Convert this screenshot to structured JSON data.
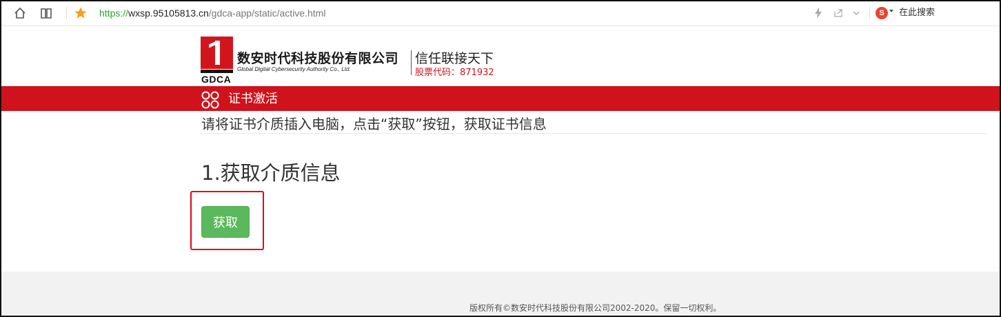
{
  "browser": {
    "url_scheme": "https://",
    "url_host": "wxsp.95105813.cn",
    "url_path": "/gdca-app/static/active.html",
    "search_label": "在此搜索",
    "search_engine_letter": "S",
    "icons": [
      "home-icon",
      "reader-icon",
      "favorite-star-icon",
      "lightning-icon",
      "share-icon",
      "chevron-down-icon",
      "sogou-icon"
    ]
  },
  "header": {
    "logo_text": "GDCA",
    "company_name_cn": "数安时代科技股份有限公司",
    "company_name_en": "Global Digital Cybersecurity Authority Co., Ltd.",
    "slogan": "信任联接天下",
    "stock_code": "股票代码：871932"
  },
  "title_bar": {
    "title": "证书激活",
    "icon": "grid-circles-icon",
    "color": "#cf121c"
  },
  "main": {
    "instruction": "请将证书介质插入电脑，点击“获取”按钮，获取证书信息",
    "step_title": "1.获取介质信息",
    "get_button_label": "获取",
    "button_color": "#5cb85c",
    "highlight_color": "#e60012"
  },
  "footer": {
    "copyright": "版权所有©数安时代科技股份有限公司2002-2020。保留一切权利。"
  }
}
